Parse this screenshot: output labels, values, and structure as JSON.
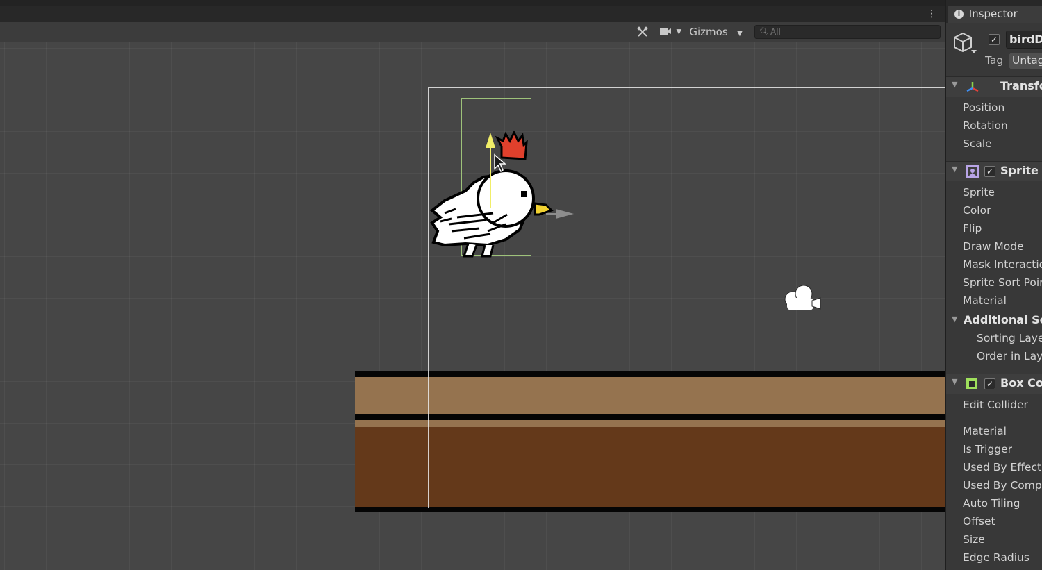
{
  "toolbar": {
    "tools_icon": "crossed-tools-icon",
    "camera_icon": "camera-icon",
    "gizmos_label": "Gizmos",
    "search_placeholder": "All",
    "search_icon": "search-icon"
  },
  "inspector": {
    "tab_label": "Inspector",
    "object_name": "birdD",
    "active": true,
    "tag_label": "Tag",
    "tag_value": "Untag",
    "components": {
      "transform": {
        "title": "Transfo",
        "fields": [
          "Position",
          "Rotation",
          "Scale"
        ]
      },
      "sprite_renderer": {
        "title": "Sprite R",
        "enabled": true,
        "fields": [
          "Sprite",
          "Color",
          "Flip",
          "Draw Mode",
          "Mask Interactio",
          "Sprite Sort Poir",
          "Material"
        ],
        "additional": {
          "title": "Additional Set",
          "fields": [
            "Sorting Laye",
            "Order in Lay"
          ]
        }
      },
      "box_collider": {
        "title": "Box Col",
        "enabled": true,
        "edit_collider": "Edit Collider",
        "fields": [
          "Material",
          "Is Trigger",
          "Used By Effect",
          "Used By Comp",
          "Auto Tiling",
          "Offset",
          "Size",
          "Edge Radius"
        ]
      }
    }
  },
  "colors": {
    "ground_top": "#95734f",
    "ground_bottom": "#64391a",
    "crown": "#e0402c",
    "beak": "#f2d230",
    "gizmo_y": "#f1ee68"
  }
}
